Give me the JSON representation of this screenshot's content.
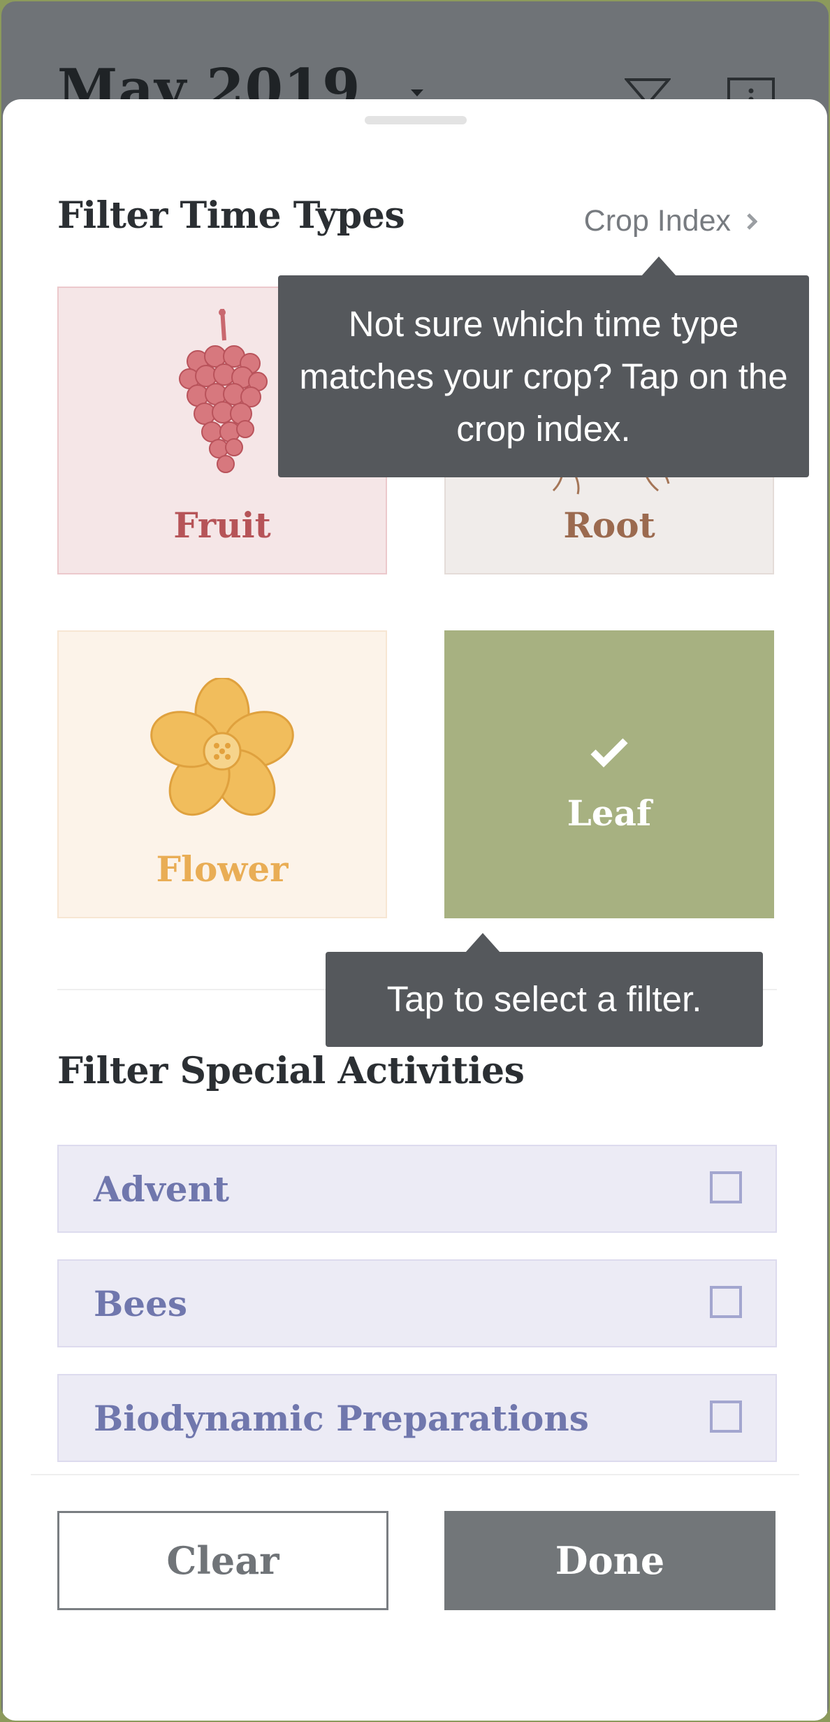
{
  "background": {
    "title": "May 2019"
  },
  "time_types": {
    "title": "Filter Time Types",
    "crop_index_label": "Crop Index",
    "tiles": [
      {
        "label": "Fruit",
        "selected": false,
        "icon": "grapes-icon"
      },
      {
        "label": "Root",
        "selected": false,
        "icon": "root-icon"
      },
      {
        "label": "Flower",
        "selected": false,
        "icon": "flower-icon"
      },
      {
        "label": "Leaf",
        "selected": true,
        "icon": "check-icon"
      }
    ]
  },
  "tooltips": {
    "crop_index": "Not sure which time type matches your crop? Tap on the crop index.",
    "select_filter": "Tap to select a filter."
  },
  "special_activities": {
    "title": "Filter Special Activities",
    "items": [
      {
        "label": "Advent",
        "checked": false
      },
      {
        "label": "Bees",
        "checked": false
      },
      {
        "label": "Biodynamic Preparations",
        "checked": false
      }
    ]
  },
  "footer": {
    "clear_label": "Clear",
    "done_label": "Done"
  },
  "colors": {
    "fruit": "#b65458",
    "root": "#9b6a4f",
    "flower": "#e9ad55",
    "leaf": "#a7b181",
    "activity_text": "#7077ad",
    "tooltip_bg": "#55585c"
  }
}
